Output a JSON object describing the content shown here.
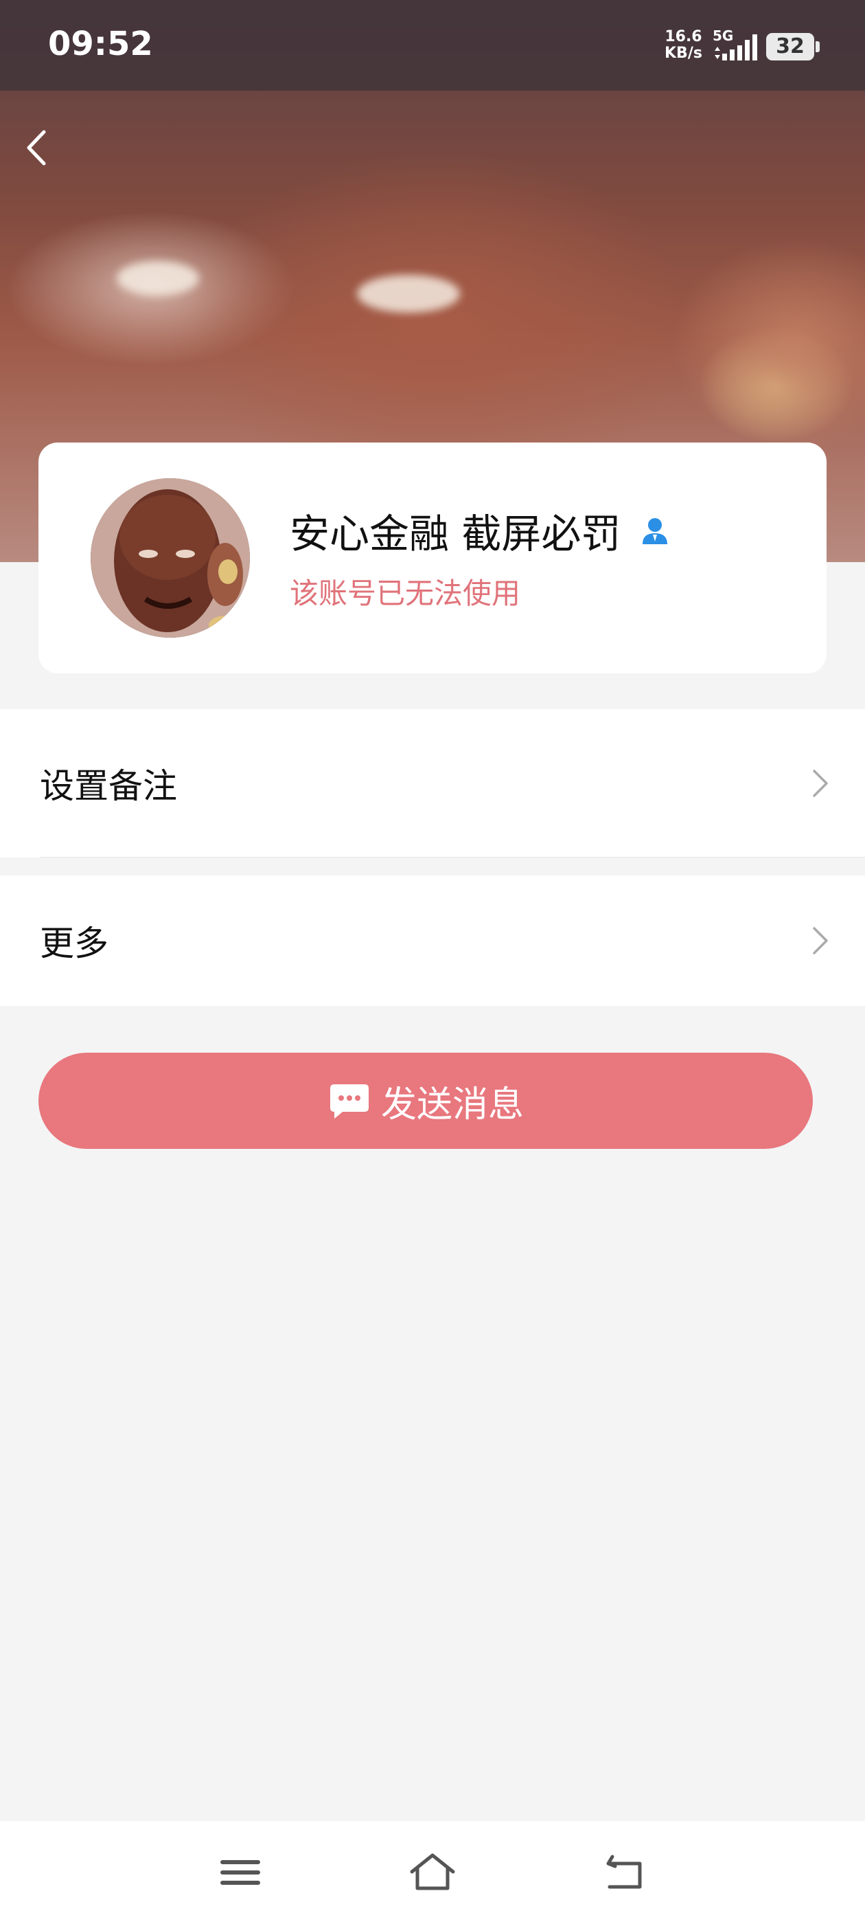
{
  "status_bar": {
    "time": "09:52",
    "net_speed_value": "16.6",
    "net_speed_unit": "KB/s",
    "signal_label": "5G",
    "battery": "32"
  },
  "header": {
    "back_icon": "chevron-left-icon"
  },
  "profile": {
    "name": "安心金融 截屏必罚",
    "status": "该账号已无法使用",
    "badge_icon": "user-icon"
  },
  "menu": [
    {
      "label": "设置备注",
      "icon": "chevron-right-icon"
    },
    {
      "label": "更多",
      "icon": "chevron-right-icon"
    }
  ],
  "send_button": {
    "label": "发送消息",
    "icon": "chat-bubble-icon",
    "color": "#e8777e"
  },
  "nav_bar": {
    "menu_icon": "menu-icon",
    "home_icon": "home-icon",
    "back_icon": "back-icon"
  },
  "colors": {
    "accent": "#e8777e",
    "status_text": "#e0737a",
    "badge": "#2b8fe6"
  }
}
